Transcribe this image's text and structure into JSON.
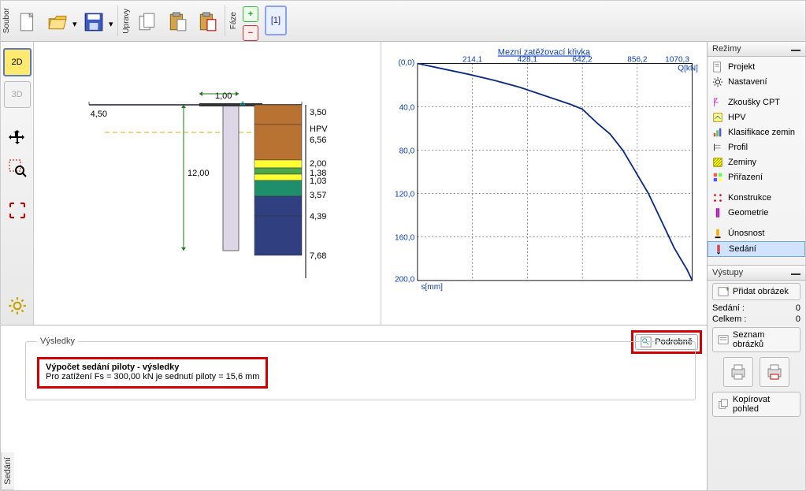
{
  "toolbar": {
    "vert1": "Soubor",
    "vert2": "Úpravy",
    "vert3": "Fáze",
    "phase1": "[1]",
    "plus": "+"
  },
  "leftbar": {
    "twoD": "2D",
    "threeD": "3D"
  },
  "drawing": {
    "dim_left": "4,50",
    "dim_top": "1,00",
    "dim_depth": "12,00",
    "segs": [
      "3,50",
      "HPV",
      "6,56",
      "2,00",
      "1,38",
      "1,03",
      "3,57",
      "4,39",
      "7,68"
    ],
    "colors": [
      "#b87333",
      "#b87333",
      "#ffff33",
      "#4aa84a",
      "#ffff33",
      "#1f8f6b",
      "#2f3f7f"
    ]
  },
  "chart_data": {
    "type": "line",
    "title": "Mezní zatěžovací křivka",
    "xlabel": "Q[kN]",
    "ylabel": "s[mm]",
    "origin": "(0,0)",
    "x_ticks": [
      "214,1",
      "428,1",
      "642,2",
      "856,2",
      "1070,3"
    ],
    "y_ticks": [
      "40,0",
      "80,0",
      "120,0",
      "160,0",
      "200,0"
    ],
    "xlim": [
      0,
      1070.3
    ],
    "ylim": [
      0,
      200
    ],
    "x": [
      0,
      100,
      200,
      300,
      400,
      500,
      600,
      642,
      700,
      750,
      800,
      850,
      900,
      950,
      1000,
      1050,
      1070.3
    ],
    "y": [
      0,
      5,
      10,
      15.6,
      22,
      30,
      38,
      42,
      55,
      65,
      80,
      100,
      120,
      145,
      170,
      190,
      200
    ]
  },
  "modes": {
    "header": "Režimy",
    "items": [
      {
        "label": "Projekt",
        "icon": "page"
      },
      {
        "label": "Nastavení",
        "icon": "gear"
      },
      {
        "label": "Zkoušky CPT",
        "icon": "cpt"
      },
      {
        "label": "HPV",
        "icon": "hpv"
      },
      {
        "label": "Klasifikace zemin",
        "icon": "bars"
      },
      {
        "label": "Profil",
        "icon": "profile"
      },
      {
        "label": "Zeminy",
        "icon": "hatch"
      },
      {
        "label": "Přiřazení",
        "icon": "assign"
      },
      {
        "label": "Konstrukce",
        "icon": "dots"
      },
      {
        "label": "Geometrie",
        "icon": "geom"
      },
      {
        "label": "Únosnost",
        "icon": "bearing"
      },
      {
        "label": "Sedání",
        "icon": "settle",
        "selected": true
      }
    ]
  },
  "outputs": {
    "header": "Výstupy",
    "add_img": "Přidat obrázek",
    "sedani_lbl": "Sedání :",
    "sedani_val": "0",
    "total_lbl": "Celkem :",
    "total_val": "0",
    "list": "Seznam obrázků",
    "copy": "Kopírovat pohled"
  },
  "results": {
    "legend": "Výsledky",
    "title": "Výpočet sedání piloty - výsledky",
    "line": "Pro zatížení Fs = 300,00 kN je sednutí piloty = 15,6 mm",
    "podrobne": "Podrobně",
    "tab": "Sedání"
  }
}
